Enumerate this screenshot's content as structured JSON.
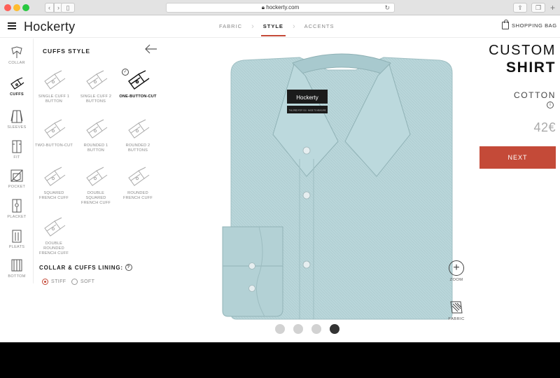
{
  "browser": {
    "url": "hockerty.com",
    "icons": [
      "back-icon",
      "forward-icon",
      "sidebar-icon",
      "lock-icon",
      "reload-icon",
      "share-icon",
      "tabs-icon",
      "new-tab-icon"
    ]
  },
  "header": {
    "logo": "Hockerty",
    "steps": [
      {
        "label": "FABRIC",
        "active": false
      },
      {
        "label": "STYLE",
        "active": true
      },
      {
        "label": "ACCENTS",
        "active": false
      }
    ],
    "bag_label": "SHOPPING BAG"
  },
  "sidebar": {
    "items": [
      {
        "label": "COLLAR",
        "icon": "collar-icon",
        "active": false
      },
      {
        "label": "CUFFS",
        "icon": "cuffs-icon",
        "active": true
      },
      {
        "label": "SLEEVES",
        "icon": "sleeves-icon",
        "active": false
      },
      {
        "label": "FIT",
        "icon": "fit-icon",
        "active": false
      },
      {
        "label": "POCKET",
        "icon": "pocket-icon",
        "active": false
      },
      {
        "label": "PLACKET",
        "icon": "placket-icon",
        "active": false
      },
      {
        "label": "PLEATS",
        "icon": "pleats-icon",
        "active": false
      },
      {
        "label": "BOTTOM",
        "icon": "bottom-icon",
        "active": false
      }
    ]
  },
  "panel": {
    "title": "CUFFS STYLE",
    "options": [
      {
        "label": "SINGLE CUFF 1 BUTTON",
        "selected": false
      },
      {
        "label": "SINGLE CUFF 2 BUTTONS",
        "selected": false
      },
      {
        "label": "ONE-BUTTON-CUT",
        "selected": true
      },
      {
        "label": "TWO-BUTTON-CUT",
        "selected": false
      },
      {
        "label": "ROUNDED 1 BUTTON",
        "selected": false
      },
      {
        "label": "ROUNDED 2 BUTTONS",
        "selected": false
      },
      {
        "label": "SQUARED FRENCH CUFF",
        "selected": false
      },
      {
        "label": "DOUBLE SQUARED FRENCH CUFF",
        "selected": false
      },
      {
        "label": "ROUNDED FRENCH CUFF",
        "selected": false
      },
      {
        "label": "DOUBLE ROUNDED FRENCH CUFF",
        "selected": false
      }
    ],
    "lining_title": "COLLAR & CUFFS LINING:",
    "lining_options": [
      {
        "label": "STIFF",
        "selected": true
      },
      {
        "label": "SOFT",
        "selected": false
      }
    ]
  },
  "product": {
    "label_brand": "Hockerty",
    "label_sub": "TAILORED FOR YOU · MADE TO MEASURE",
    "shirt_color": "#b9d6da",
    "carousel": {
      "count": 4,
      "active_index": 3
    }
  },
  "tools": {
    "zoom_label": "ZOOM",
    "fabric_label": "FABRIC"
  },
  "summary": {
    "title_line1": "CUSTOM",
    "title_line2": "SHIRT",
    "fabric": "COTTON",
    "price": "42€",
    "next_label": "NEXT"
  },
  "colors": {
    "accent": "#c44a38",
    "text": "#222222",
    "muted": "#888888"
  }
}
